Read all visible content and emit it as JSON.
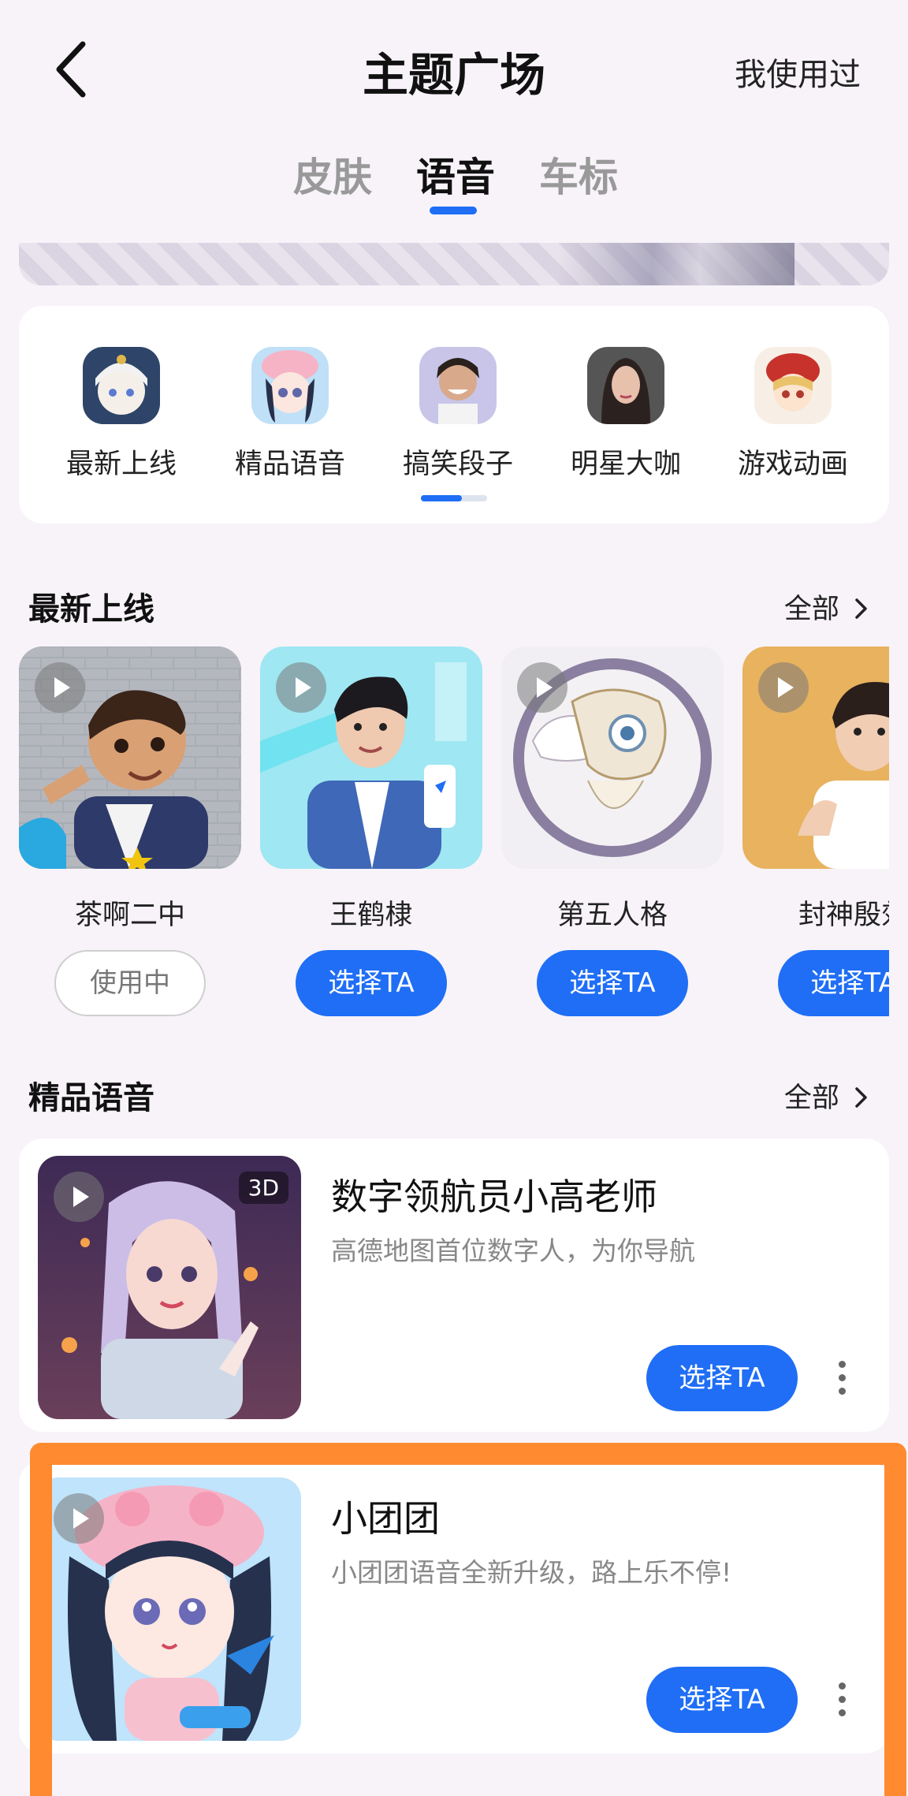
{
  "header": {
    "title": "主题广场",
    "used_label": "我使用过"
  },
  "tabs": [
    {
      "label": "皮肤",
      "active": false
    },
    {
      "label": "语音",
      "active": true
    },
    {
      "label": "车标",
      "active": false
    }
  ],
  "categories": [
    {
      "label": "最新上线",
      "icon": "anime-white-hair-avatar"
    },
    {
      "label": "精品语音",
      "icon": "anime-pig-hat-avatar"
    },
    {
      "label": "搞笑段子",
      "icon": "smiling-woman-avatar"
    },
    {
      "label": "明星大咖",
      "icon": "celebrity-woman-avatar"
    },
    {
      "label": "游戏动画",
      "icon": "anime-red-hat-avatar"
    }
  ],
  "latest": {
    "title": "最新上线",
    "more": "全部",
    "items": [
      {
        "name": "茶啊二中",
        "button": "使用中",
        "state": "in-use"
      },
      {
        "name": "王鹤棣",
        "button": "选择TA",
        "state": "select"
      },
      {
        "name": "第五人格",
        "button": "选择TA",
        "state": "select"
      },
      {
        "name": "封神殷郊",
        "button": "选择TA",
        "state": "select"
      }
    ]
  },
  "premium": {
    "title": "精品语音",
    "more": "全部",
    "items": [
      {
        "title": "数字领航员小高老师",
        "desc": "高德地图首位数字人，为你导航",
        "badge": "3D",
        "button": "选择TA"
      },
      {
        "title": "小团团",
        "desc": "小团团语音全新升级，路上乐不停!",
        "badge": "",
        "button": "选择TA"
      }
    ]
  },
  "colors": {
    "accent": "#1f6ef5",
    "highlight": "#ff8a30",
    "background": "#f7f3f9"
  }
}
